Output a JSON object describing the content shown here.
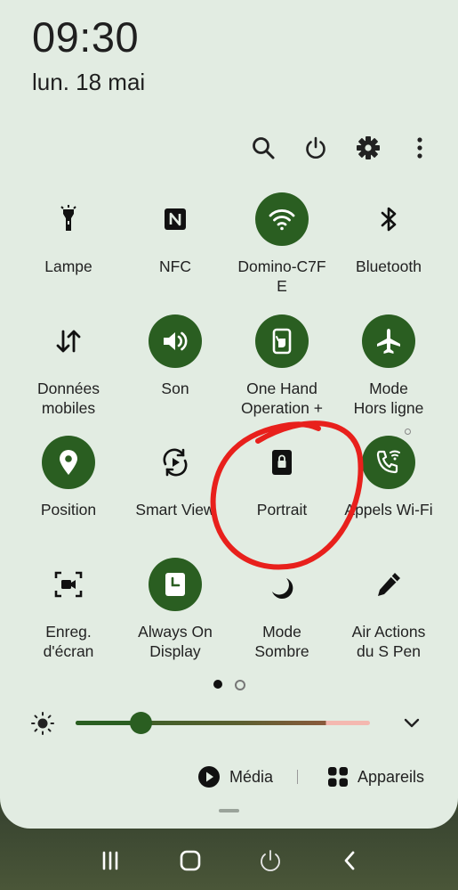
{
  "status": {
    "time": "09:30",
    "date": "lun. 18 mai"
  },
  "toolbar_icons": [
    "search-icon",
    "power-icon",
    "gear-icon",
    "more-vertical-icon"
  ],
  "tiles": [
    {
      "label": "Lampe",
      "icon": "flashlight-icon",
      "on": false
    },
    {
      "label": "NFC",
      "icon": "nfc-icon",
      "on": false
    },
    {
      "label": "Domino-C7F\nE",
      "icon": "wifi-icon",
      "on": true
    },
    {
      "label": "Bluetooth",
      "icon": "bluetooth-icon",
      "on": false
    },
    {
      "label": "Données\nmobiles",
      "icon": "mobile-data-icon",
      "on": false
    },
    {
      "label": "Son",
      "icon": "sound-icon",
      "on": true
    },
    {
      "label": "One Hand\nOperation +",
      "icon": "one-hand-icon",
      "on": true
    },
    {
      "label": "Mode\nHors ligne",
      "icon": "airplane-icon",
      "on": true
    },
    {
      "label": "Position",
      "icon": "location-icon",
      "on": true
    },
    {
      "label": "Smart View",
      "icon": "smart-view-icon",
      "on": false
    },
    {
      "label": "Portrait",
      "icon": "portrait-lock-icon",
      "on": false
    },
    {
      "label": "Appels Wi-Fi",
      "icon": "wifi-calling-icon",
      "on": true
    },
    {
      "label": "Enreg.\nd'écran",
      "icon": "screen-record-icon",
      "on": false
    },
    {
      "label": "Always On\nDisplay",
      "icon": "always-on-display-icon",
      "on": true
    },
    {
      "label": "Mode\nSombre",
      "icon": "moon-icon",
      "on": false
    },
    {
      "label": "Air Actions\ndu S Pen",
      "icon": "pen-icon",
      "on": false
    }
  ],
  "pager": {
    "current": 1,
    "total": 2
  },
  "brightness": {
    "level": 0.22
  },
  "bottom": {
    "media_label": "Média",
    "devices_label": "Appareils"
  },
  "colors": {
    "accent": "#2a5e21",
    "panel": "#e2ece2",
    "annotation": "#e8201c"
  },
  "navbar": [
    "recent-apps-icon",
    "home-icon",
    "power-icon",
    "back-icon"
  ]
}
